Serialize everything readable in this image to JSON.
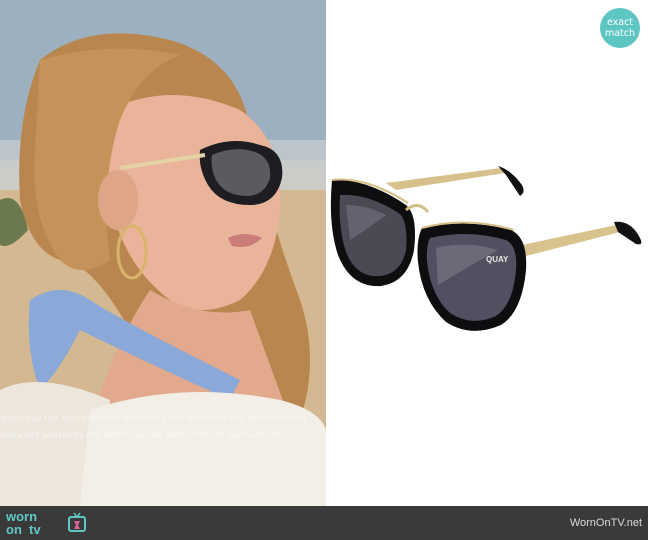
{
  "badge": {
    "line1": "exact",
    "line2": "match"
  },
  "watermark": {
    "row": "wornontv.net   wornontv.net   wornontv.net   wornontv.net   wornontv.net"
  },
  "footer": {
    "logo_line1": "worn",
    "logo_line2a": "on",
    "logo_line2b": "tv",
    "site": "WornOnTV.net"
  },
  "colors": {
    "accent": "#5ec6c2",
    "footer_bg": "#3a3a3a"
  },
  "icons": [
    "tv-icon"
  ]
}
